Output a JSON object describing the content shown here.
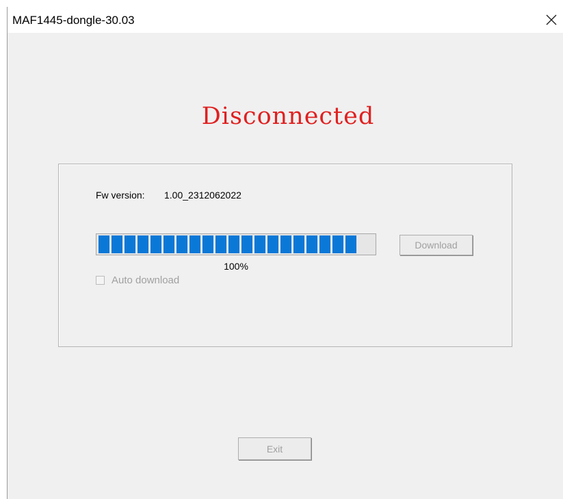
{
  "window": {
    "title": "MAF1445-dongle-30.03"
  },
  "status": {
    "text": "Disconnected",
    "color": "#e02020"
  },
  "firmware": {
    "label": "Fw version:",
    "value": "1.00_2312062022"
  },
  "progress": {
    "value": 1.0,
    "percent_text": "100%",
    "bar_color": "#0a78d7"
  },
  "buttons": {
    "download": "Download",
    "exit": "Exit"
  },
  "auto_download": {
    "label": "Auto download",
    "checked": false,
    "enabled": false
  },
  "icons": {
    "close": "close-icon"
  }
}
